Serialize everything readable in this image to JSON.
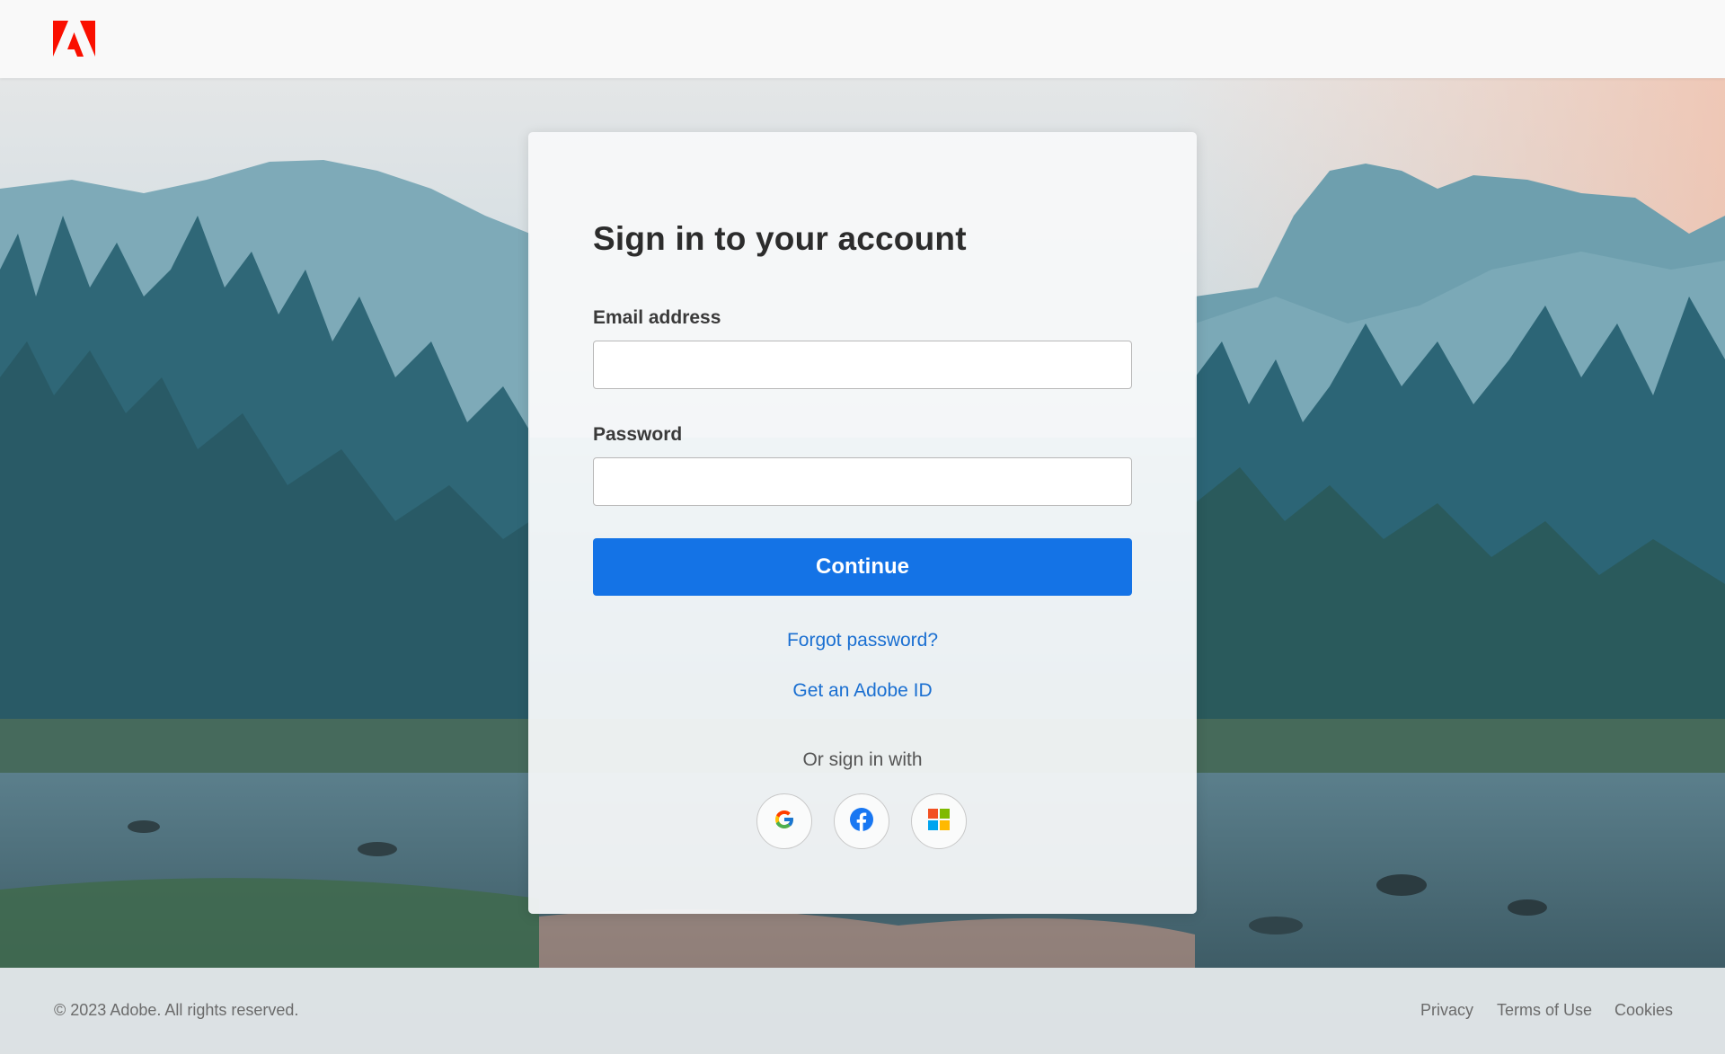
{
  "header": {
    "logo_icon": "adobe-logo-icon",
    "brand_color": "#fa0f00"
  },
  "signin": {
    "title": "Sign in to your account",
    "email_label": "Email address",
    "email_value": "",
    "password_label": "Password",
    "password_value": "",
    "continue_label": "Continue",
    "forgot_password": "Forgot password?",
    "get_adobe_id": "Get an Adobe ID",
    "or_sign_in_with": "Or sign in with",
    "social": [
      {
        "name": "google",
        "icon": "google-icon"
      },
      {
        "name": "facebook",
        "icon": "facebook-icon"
      },
      {
        "name": "microsoft",
        "icon": "microsoft-icon"
      }
    ]
  },
  "footer": {
    "copyright": "© 2023 Adobe. All rights reserved.",
    "links": [
      "Privacy",
      "Terms of Use",
      "Cookies"
    ]
  },
  "colors": {
    "accent": "#1473e6",
    "link": "#1a6fd1",
    "title": "#2c2c2c"
  }
}
